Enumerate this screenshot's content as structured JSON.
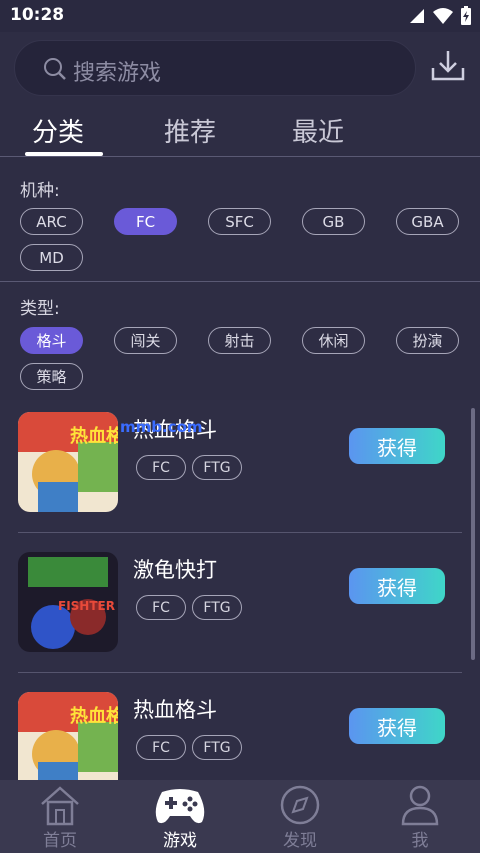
{
  "status": {
    "time": "10:28"
  },
  "search": {
    "placeholder": "搜索游戏"
  },
  "tabs": [
    {
      "label": "分类",
      "active": true
    },
    {
      "label": "推荐",
      "active": false
    },
    {
      "label": "最近",
      "active": false
    }
  ],
  "filters": {
    "platform_label": "机种:",
    "platforms": [
      "ARC",
      "FC",
      "SFC",
      "GB",
      "GBA",
      "MD"
    ],
    "platform_selected": "FC",
    "type_label": "类型:",
    "types": [
      "格斗",
      "闯关",
      "射击",
      "休闲",
      "扮演",
      "策略"
    ],
    "type_selected": "格斗"
  },
  "games": [
    {
      "title": "热血格斗",
      "tags": [
        "FC",
        "FTG"
      ],
      "button": "获得",
      "thumb_text": "热血格斗"
    },
    {
      "title": "激龟快打",
      "tags": [
        "FC",
        "FTG"
      ],
      "button": "获得",
      "thumb_text": "FISHTER"
    },
    {
      "title": "热血格斗",
      "tags": [
        "FC",
        "FTG"
      ],
      "button": "获得",
      "thumb_text": "热血格斗"
    }
  ],
  "watermark": "mmb.com",
  "bottom_nav": [
    {
      "label": "首页",
      "icon": "home-icon",
      "active": false
    },
    {
      "label": "游戏",
      "icon": "gamepad-icon",
      "active": true
    },
    {
      "label": "发现",
      "icon": "compass-icon",
      "active": false
    },
    {
      "label": "我",
      "icon": "user-icon",
      "active": false
    }
  ],
  "colors": {
    "accent": "#6a5ad8",
    "button_from": "#5b95f0",
    "button_to": "#3fd6c8",
    "bg": "#2b2a3f"
  }
}
